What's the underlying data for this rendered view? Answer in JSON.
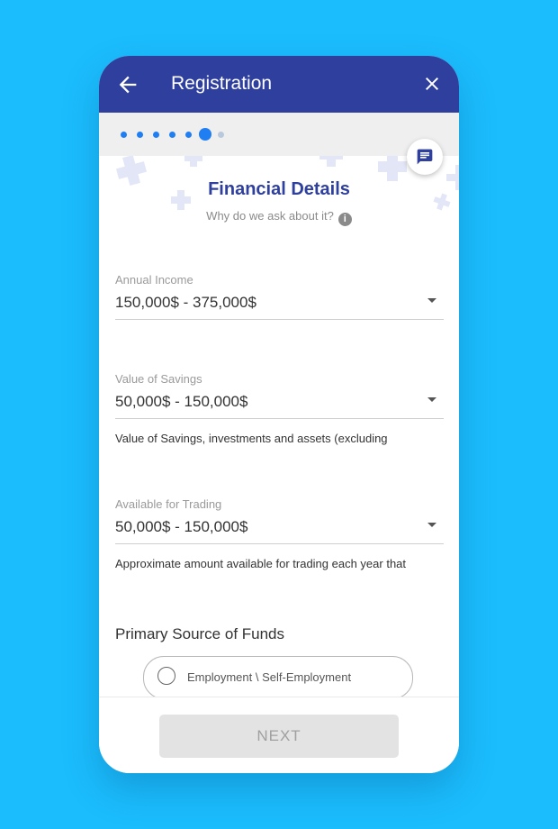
{
  "appbar": {
    "title": "Registration"
  },
  "stepper": {
    "total_steps": 7,
    "current_step": 6
  },
  "section": {
    "title": "Financial Details",
    "why_text": "Why do we ask about it?"
  },
  "fields": [
    {
      "label": "Annual Income",
      "value": "150,000$ - 375,000$",
      "helper": ""
    },
    {
      "label": "Value of Savings",
      "value": "50,000$ - 150,000$",
      "helper": "Value of Savings, investments and assets (excluding"
    },
    {
      "label": "Available for Trading",
      "value": "50,000$ - 150,000$",
      "helper": "Approximate amount available for trading each year that"
    }
  ],
  "funds": {
    "title": "Primary Source of Funds",
    "options": [
      {
        "label": "Employment \\ Self-Employment",
        "selected": false
      }
    ]
  },
  "footer": {
    "next_label": "NEXT",
    "next_enabled": false
  },
  "colors": {
    "background": "#1bbdfd",
    "appbar": "#2e3f9e",
    "accent_blue": "#1e7ef2",
    "dot_inactive": "#b9c8dc"
  },
  "icons": {
    "back": "arrow-left-icon",
    "close": "close-icon",
    "chat": "chat-icon",
    "info": "info-icon"
  }
}
